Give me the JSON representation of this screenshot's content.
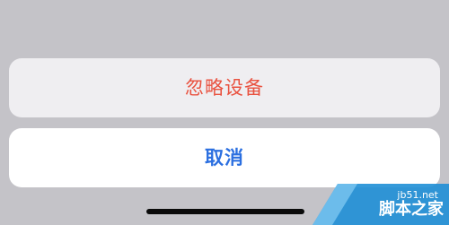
{
  "action_sheet": {
    "actions": [
      {
        "label": "忽略设备",
        "style": "destructive",
        "color": "#e9513f"
      }
    ],
    "cancel": {
      "label": "取消",
      "color": "#2b6fe0"
    }
  },
  "watermark": {
    "url": "jb51.net",
    "name": "脚本之家"
  }
}
